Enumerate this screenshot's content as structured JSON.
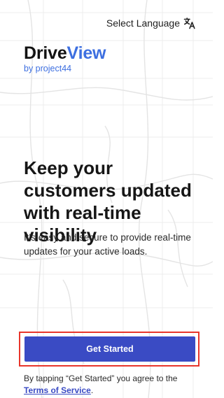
{
  "header": {
    "select_language_label": "Select Language",
    "language_icon": "translate-icon"
  },
  "brand": {
    "name_part1": "Drive",
    "name_part2": "View",
    "subtitle": "by project44"
  },
  "main": {
    "headline": "Keep your customers updated with real-time visibility",
    "description": "It's easy and secure to provide real-time updates for your active loads."
  },
  "cta": {
    "label": "Get Started"
  },
  "legal": {
    "prefix": "By tapping “Get Started” you agree to the ",
    "link_label": "Terms of Service",
    "suffix": "."
  },
  "colors": {
    "brand_blue": "#3d6fe0",
    "button_bg": "#3a4bc4",
    "highlight_border": "#e8352b"
  }
}
